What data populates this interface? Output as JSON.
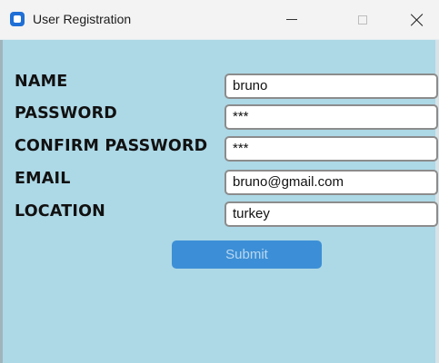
{
  "window": {
    "title": "User Registration"
  },
  "form": {
    "fields": [
      {
        "label": "NAME",
        "value": "bruno"
      },
      {
        "label": "PASSWORD",
        "value": "***"
      },
      {
        "label": "CONFIRM PASSWORD",
        "value": "***"
      },
      {
        "label": "EMAIL",
        "value": "bruno@gmail.com"
      },
      {
        "label": "LOCATION",
        "value": "turkey"
      }
    ],
    "submit_label": "Submit"
  },
  "icons": {
    "app": "app-icon",
    "minimize": "minimize-icon",
    "maximize": "maximize-icon",
    "close": "close-icon"
  },
  "colors": {
    "background": "#add8e6",
    "submit": "#3c8fd6",
    "app_icon": "#1f6fd6"
  }
}
